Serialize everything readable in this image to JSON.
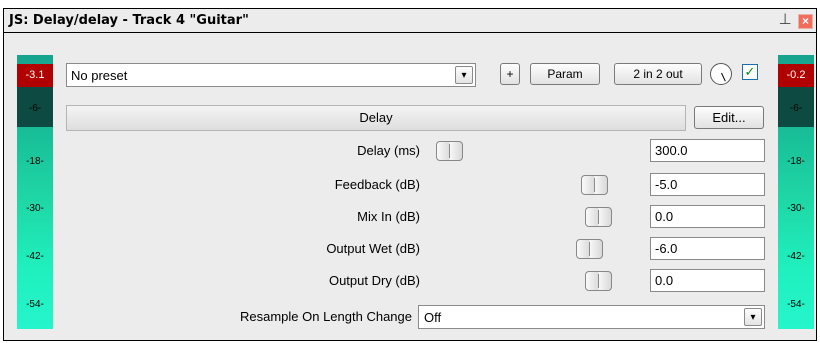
{
  "window": {
    "title": "JS: Delay/delay - Track 4 \"Guitar\"",
    "pin_icon": "pin-icon",
    "close_icon": "close-icon",
    "close_glyph": "×",
    "pin_glyph": "⊥"
  },
  "meters": {
    "left": {
      "peak": "-3.1",
      "ticks": [
        "-6-",
        "-18-",
        "-30-",
        "-42-",
        "-54-"
      ]
    },
    "right": {
      "peak": "-0.2",
      "ticks": [
        "-6-",
        "-18-",
        "-30-",
        "-42-",
        "-54-"
      ]
    },
    "color_top": "#17a38e",
    "color_bottom": "#25f5cb",
    "peak_color": "#b00000"
  },
  "toolbar": {
    "preset_value": "No preset",
    "preset_dropdown_glyph": "▾",
    "add_label": "+",
    "param_label": "Param",
    "io_label": "2 in 2 out",
    "wet_knob_icon": "knob-icon",
    "bypass_checked": true,
    "check_glyph": "✓"
  },
  "section": {
    "title": "Delay",
    "edit_label": "Edit..."
  },
  "params": [
    {
      "label": "Delay (ms)",
      "value": "300.0",
      "position": 0.03
    },
    {
      "label": "Feedback (dB)",
      "value": "-5.0",
      "position": 0.8
    },
    {
      "label": "Mix In (dB)",
      "value": "0.0",
      "position": 0.82
    },
    {
      "label": "Output Wet (dB)",
      "value": "-6.0",
      "position": 0.77
    },
    {
      "label": "Output Dry (dB)",
      "value": "0.0",
      "position": 0.82
    }
  ],
  "resample": {
    "label": "Resample On Length Change",
    "value": "Off",
    "dropdown_glyph": "▾"
  }
}
